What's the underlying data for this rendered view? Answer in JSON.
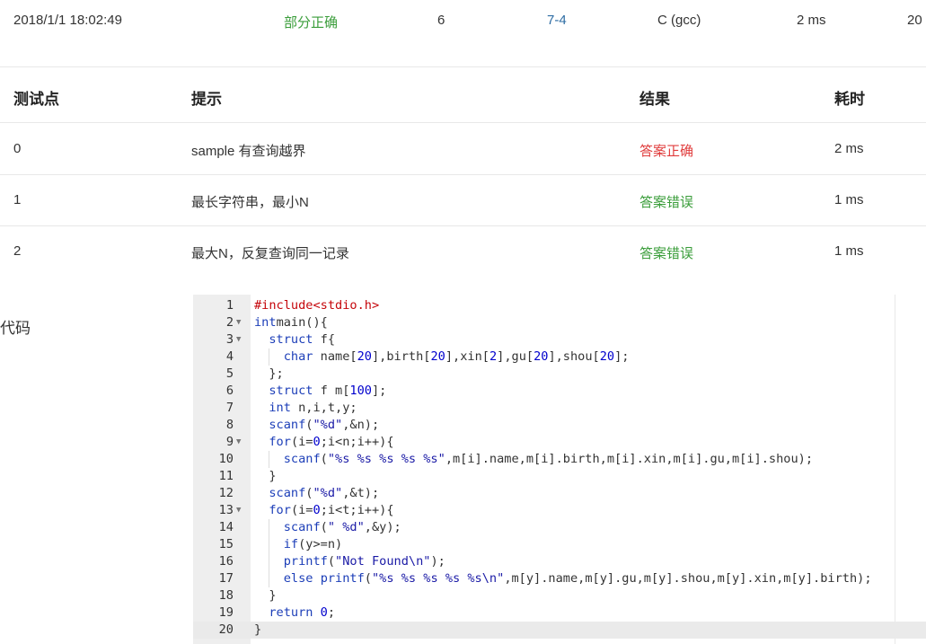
{
  "submission": {
    "time": "2018/1/1 18:02:49",
    "status": "部分正确",
    "score": "6",
    "problem": "7-4",
    "compiler": "C (gcc)",
    "duration": "2 ms",
    "user_truncated": "20"
  },
  "test_table": {
    "headers": [
      "测试点",
      "提示",
      "结果",
      "耗时"
    ],
    "rows": [
      {
        "id": "0",
        "hint": "sample 有查询越界",
        "result": "答案正确",
        "time": "2 ms"
      },
      {
        "id": "1",
        "hint": "最长字符串，最小N",
        "result": "答案错误",
        "time": "1 ms"
      },
      {
        "id": "2",
        "hint": "最大N，反复查询同一记录",
        "result": "答案错误",
        "time": "1 ms"
      }
    ]
  },
  "code_section": {
    "label": "代码",
    "lines": [
      {
        "n": "1",
        "fold": false,
        "segs": [
          [
            "inc",
            "#include<stdio.h>"
          ]
        ]
      },
      {
        "n": "2",
        "fold": true,
        "segs": [
          [
            "kw",
            "int"
          ],
          [
            "",
            "main(){"
          ]
        ]
      },
      {
        "n": "3",
        "fold": true,
        "segs": [
          [
            "",
            "  "
          ],
          [
            "kw",
            "struct"
          ],
          [
            "",
            " f{"
          ]
        ]
      },
      {
        "n": "4",
        "fold": false,
        "segs": [
          [
            "",
            "    "
          ],
          [
            "kw",
            "char"
          ],
          [
            "",
            " name["
          ],
          [
            "num",
            "20"
          ],
          [
            "",
            "],birth["
          ],
          [
            "num",
            "20"
          ],
          [
            "",
            "],xin["
          ],
          [
            "num",
            "2"
          ],
          [
            "",
            "],gu["
          ],
          [
            "num",
            "20"
          ],
          [
            "",
            "],shou["
          ],
          [
            "num",
            "20"
          ],
          [
            "",
            "];"
          ]
        ]
      },
      {
        "n": "5",
        "fold": false,
        "segs": [
          [
            "",
            "  };"
          ]
        ]
      },
      {
        "n": "6",
        "fold": false,
        "segs": [
          [
            "",
            "  "
          ],
          [
            "kw",
            "struct"
          ],
          [
            "",
            " f m["
          ],
          [
            "num",
            "100"
          ],
          [
            "",
            "];"
          ]
        ]
      },
      {
        "n": "7",
        "fold": false,
        "segs": [
          [
            "",
            "  "
          ],
          [
            "kw",
            "int"
          ],
          [
            "",
            " n,i,t,y;"
          ]
        ]
      },
      {
        "n": "8",
        "fold": false,
        "segs": [
          [
            "",
            "  "
          ],
          [
            "kw",
            "scanf"
          ],
          [
            "",
            "("
          ],
          [
            "str",
            "\"%d\""
          ],
          [
            "",
            ",&n);"
          ]
        ]
      },
      {
        "n": "9",
        "fold": true,
        "segs": [
          [
            "",
            "  "
          ],
          [
            "kw",
            "for"
          ],
          [
            "",
            "(i="
          ],
          [
            "num",
            "0"
          ],
          [
            "",
            ";i<n;i++){"
          ]
        ]
      },
      {
        "n": "10",
        "fold": false,
        "segs": [
          [
            "",
            "    "
          ],
          [
            "kw",
            "scanf"
          ],
          [
            "",
            "("
          ],
          [
            "str",
            "\"%s %s %s %s %s\""
          ],
          [
            "",
            ",m[i].name,m[i].birth,m[i].xin,m[i].gu,m[i].shou);"
          ]
        ]
      },
      {
        "n": "11",
        "fold": false,
        "segs": [
          [
            "",
            "  }"
          ]
        ]
      },
      {
        "n": "12",
        "fold": false,
        "segs": [
          [
            "",
            "  "
          ],
          [
            "kw",
            "scanf"
          ],
          [
            "",
            "("
          ],
          [
            "str",
            "\"%d\""
          ],
          [
            "",
            ",&t);"
          ]
        ]
      },
      {
        "n": "13",
        "fold": true,
        "segs": [
          [
            "",
            "  "
          ],
          [
            "kw",
            "for"
          ],
          [
            "",
            "(i="
          ],
          [
            "num",
            "0"
          ],
          [
            "",
            ";i<t;i++){"
          ]
        ]
      },
      {
        "n": "14",
        "fold": false,
        "segs": [
          [
            "",
            "    "
          ],
          [
            "kw",
            "scanf"
          ],
          [
            "",
            "("
          ],
          [
            "str",
            "\" %d\""
          ],
          [
            "",
            ",&y);"
          ]
        ]
      },
      {
        "n": "15",
        "fold": false,
        "segs": [
          [
            "",
            "    "
          ],
          [
            "kw",
            "if"
          ],
          [
            "",
            "(y>=n)"
          ]
        ]
      },
      {
        "n": "16",
        "fold": false,
        "segs": [
          [
            "",
            "    "
          ],
          [
            "kw",
            "printf"
          ],
          [
            "",
            "("
          ],
          [
            "str",
            "\"Not Found\\n\""
          ],
          [
            "",
            ");"
          ]
        ]
      },
      {
        "n": "17",
        "fold": false,
        "segs": [
          [
            "",
            "    "
          ],
          [
            "kw",
            "else"
          ],
          [
            "",
            " "
          ],
          [
            "kw",
            "printf"
          ],
          [
            "",
            "("
          ],
          [
            "str",
            "\"%s %s %s %s %s\\n\""
          ],
          [
            "",
            ",m[y].name,m[y].gu,m[y].shou,m[y].xin,m[y].birth);"
          ]
        ]
      },
      {
        "n": "18",
        "fold": false,
        "segs": [
          [
            "",
            "  }"
          ]
        ]
      },
      {
        "n": "19",
        "fold": false,
        "segs": [
          [
            "",
            "  "
          ],
          [
            "kw",
            "return"
          ],
          [
            "",
            " "
          ],
          [
            "num",
            "0"
          ],
          [
            "",
            ";"
          ]
        ]
      },
      {
        "n": "20",
        "fold": false,
        "active": true,
        "segs": [
          [
            "",
            "}"
          ]
        ]
      }
    ]
  },
  "icons": {
    "fold_arrow": "chevron-down-icon"
  },
  "colors": {
    "status_partial": "#3a9d3a",
    "result_correct": "#e03c3c",
    "result_wrong": "#3a9d3a",
    "problem_link": "#2e6da4",
    "keyword": "#1c3eb8",
    "string": "#1a1aa6",
    "include": "#c5060b"
  }
}
